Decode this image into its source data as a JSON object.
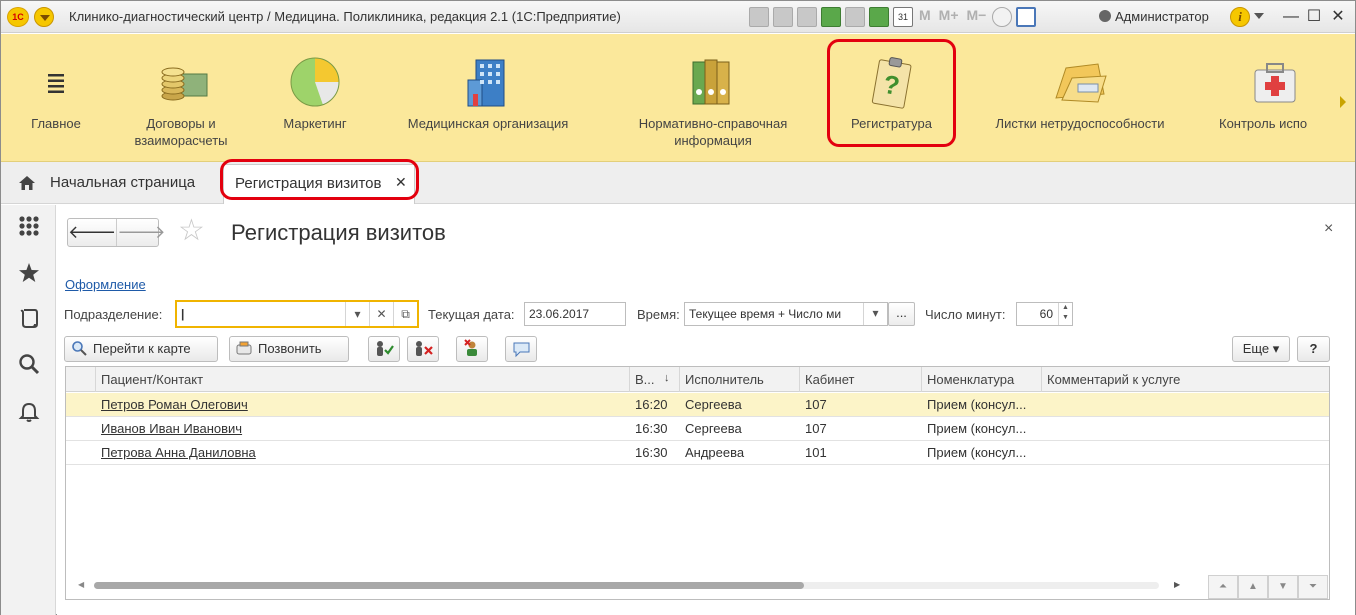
{
  "window": {
    "title": "Клинико-диагностический центр / Медицина. Поликлиника, редакция 2.1  (1С:Предприятие)",
    "logo_text": "1С",
    "user": "Администратор",
    "calendar_day": "31",
    "memory_labels": [
      "M",
      "M+",
      "M−"
    ],
    "info_glyph": "i",
    "minimize": "—",
    "maximize": "☐",
    "close": "✕"
  },
  "sections": [
    {
      "label": "Главное",
      "icon": "hamburger-icon"
    },
    {
      "label": "Договоры и\nвзаиморасчеты",
      "icon": "coins-icon"
    },
    {
      "label": "Маркетинг",
      "icon": "pie-chart-icon"
    },
    {
      "label": "Медицинская организация",
      "icon": "building-icon"
    },
    {
      "label": "Нормативно-справочная\nинформация",
      "icon": "binders-icon"
    },
    {
      "label": "Регистратура",
      "icon": "clipboard-question-icon"
    },
    {
      "label": "Листки нетрудоспособности",
      "icon": "folder-icon"
    },
    {
      "label": "Контроль испо",
      "icon": "first-aid-icon"
    }
  ],
  "tabs": {
    "home": "Начальная страница",
    "active": "Регистрация визитов",
    "close": "✕"
  },
  "form": {
    "title": "Регистрация визитов",
    "back": "🡐",
    "forward": "🡒",
    "star": "☆",
    "close": "×",
    "design_link": "Оформление",
    "department_label": "Подразделение:",
    "department_value": "|",
    "current_date_label": "Текущая дата:",
    "current_date_value": "23.06.2017",
    "time_label": "Время:",
    "time_value": "Текущее время + Число ми",
    "minutes_label": "Число минут:",
    "minutes_value": "60",
    "ellipsis": "...",
    "dropdown": "▾",
    "clear": "✕",
    "open": "⧉"
  },
  "toolbar": {
    "goto_card": "Перейти к карте",
    "call": "Позвонить",
    "more": "Еще",
    "help": "?"
  },
  "table": {
    "columns": [
      "Пациент/Контакт",
      "В...",
      "Исполнитель",
      "Кабинет",
      "Номенклатура",
      "Комментарий к услуге"
    ],
    "sort_glyph": "↓",
    "rows": [
      {
        "patient": "Петров Роман Олегович",
        "time": "16:20",
        "performer": "Сергеева",
        "room": "107",
        "nomenclature": "Прием (консул...",
        "comment": ""
      },
      {
        "patient": "Иванов Иван Иванович",
        "time": "16:30",
        "performer": "Сергеева",
        "room": "107",
        "nomenclature": "Прием (консул...",
        "comment": ""
      },
      {
        "patient": "Петрова Анна Даниловна",
        "time": "16:30",
        "performer": "Андреева",
        "room": "101",
        "nomenclature": "Прием (консул...",
        "comment": ""
      }
    ]
  },
  "colors": {
    "accent_yellow": "#fbe89b",
    "highlight_red": "#e3000f",
    "selected_row": "#fcf4c8",
    "link_blue": "#1e5aa8"
  }
}
